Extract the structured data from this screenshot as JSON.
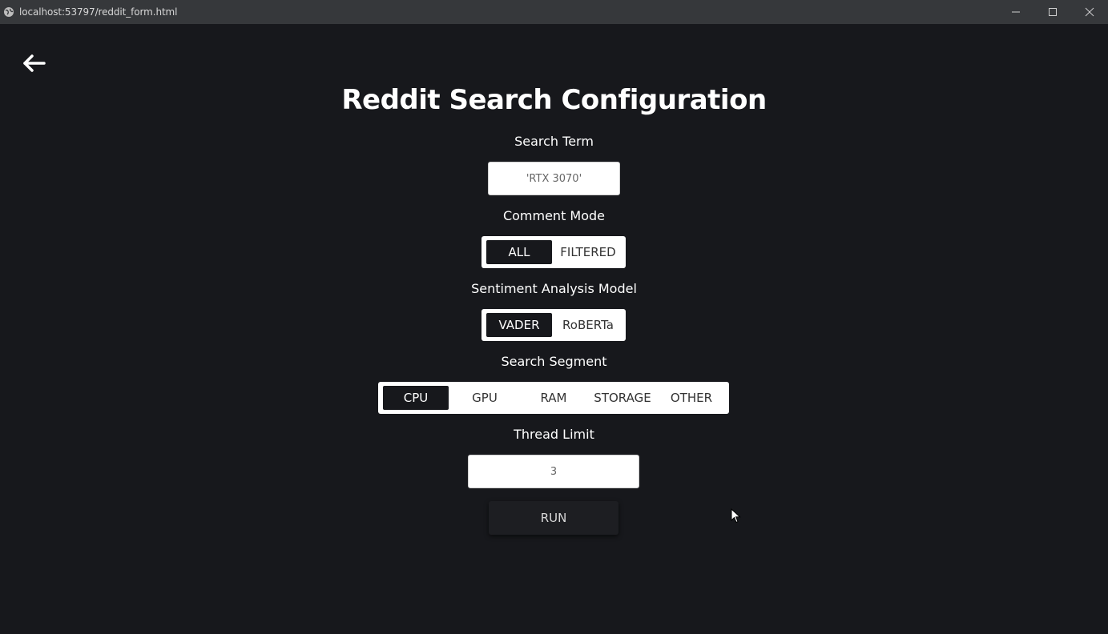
{
  "window": {
    "url": "localhost:53797/reddit_form.html"
  },
  "icons": {
    "globe": "globe-icon",
    "back": "back-arrow-icon",
    "minimize": "minimize-icon",
    "maximize": "maximize-icon",
    "close": "close-icon"
  },
  "form": {
    "title": "Reddit Search Configuration",
    "search_term": {
      "label": "Search Term",
      "value": "'RTX 3070'"
    },
    "comment_mode": {
      "label": "Comment Mode",
      "options": [
        "ALL",
        "FILTERED"
      ],
      "selected": "ALL"
    },
    "sentiment_model": {
      "label": "Sentiment Analysis Model",
      "options": [
        "VADER",
        "RoBERTa"
      ],
      "selected": "VADER"
    },
    "search_segment": {
      "label": "Search Segment",
      "options": [
        "CPU",
        "GPU",
        "RAM",
        "STORAGE",
        "OTHER"
      ],
      "selected": "CPU"
    },
    "thread_limit": {
      "label": "Thread Limit",
      "value": "3"
    },
    "run_label": "RUN"
  },
  "colors": {
    "background": "#17181c",
    "titlebar": "#36383b",
    "active_segment": "#17181c"
  }
}
